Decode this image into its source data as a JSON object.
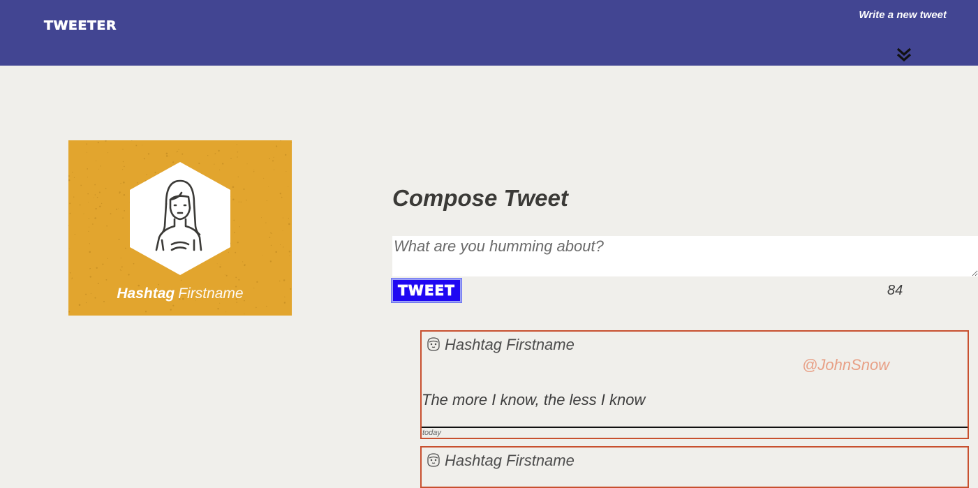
{
  "nav": {
    "brand": "TWEETER",
    "write_link": "Write a new tweet",
    "toggle_icon": "double-chevron-down-icon",
    "background": "#424592"
  },
  "profile": {
    "first_name": "Hashtag",
    "last_name": "Firstname",
    "avatar_icon": "woman-avatar-icon",
    "card_color": "#e2a52e"
  },
  "compose": {
    "title": "Compose Tweet",
    "placeholder": "What are you humming about?",
    "value": "",
    "button_label": "TWEET",
    "button_color": "#1f08f2",
    "char_count": "84"
  },
  "tweets": [
    {
      "avatar_icon": "face-avatar-icon",
      "author": "Hashtag Firstname",
      "handle": "@JohnSnow",
      "body": "The more I know, the less I know",
      "time": "today"
    },
    {
      "avatar_icon": "face-avatar-icon",
      "author": "Hashtag Firstname"
    }
  ],
  "colors": {
    "page_background": "#f0efeb",
    "tweet_border": "#c8502f",
    "handle": "#e8a086"
  }
}
